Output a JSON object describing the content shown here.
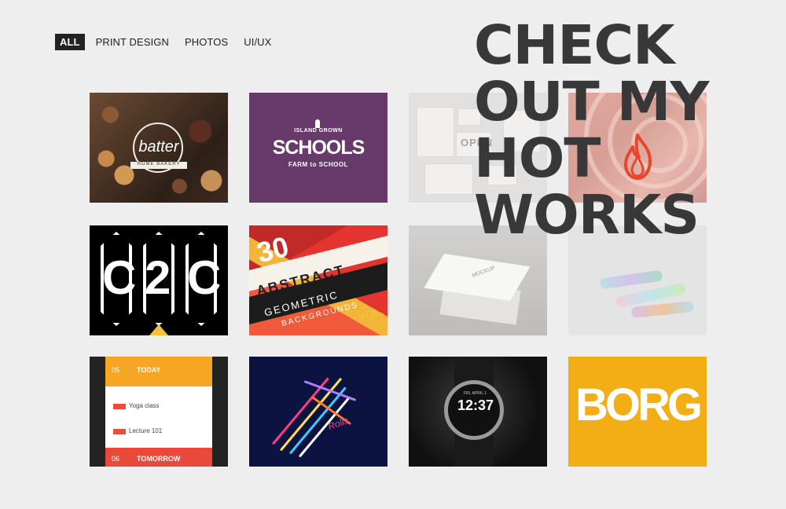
{
  "filters": [
    {
      "label": "ALL",
      "active": true
    },
    {
      "label": "PRINT DESIGN",
      "active": false
    },
    {
      "label": "PHOTOS",
      "active": false
    },
    {
      "label": "UI/UX",
      "active": false
    }
  ],
  "headline": {
    "line1": "CHECK",
    "line2": "OUT MY",
    "line3": "HOT",
    "line4": "WORKS",
    "icon": "flame-icon",
    "icon_color": "#e8452c"
  },
  "tiles": {
    "t1": {
      "word": "batter",
      "sub": "HOME BAKERY"
    },
    "t2": {
      "top": "ISLAND GROWN",
      "main": "SCHOOLS",
      "sub": "FARM to SCHOOL"
    },
    "t3": {
      "word": "OPEN"
    },
    "t5": {
      "letters": [
        "C",
        "2",
        "C"
      ]
    },
    "t6": {
      "num": "30",
      "word": "ABSTRACT",
      "geo": "GEOMETRIC",
      "bg": "BACKGROUNDS",
      "vol": "VOL."
    },
    "t7": {
      "label": "MOCKUP"
    },
    "t9": {
      "date1": "05",
      "day1": "TODAY",
      "row1": "Yoga class",
      "row2": "Lecture 101",
      "date2": "06",
      "day2": "TOMORROW"
    },
    "t10": {
      "word": "Rolls"
    },
    "t11": {
      "time": "12:37",
      "date": "FRI, APRIL 1"
    },
    "t12": {
      "word": "BORG"
    }
  },
  "colors": {
    "background": "#eeeeee",
    "text": "#383838",
    "active_filter": "#222222"
  }
}
